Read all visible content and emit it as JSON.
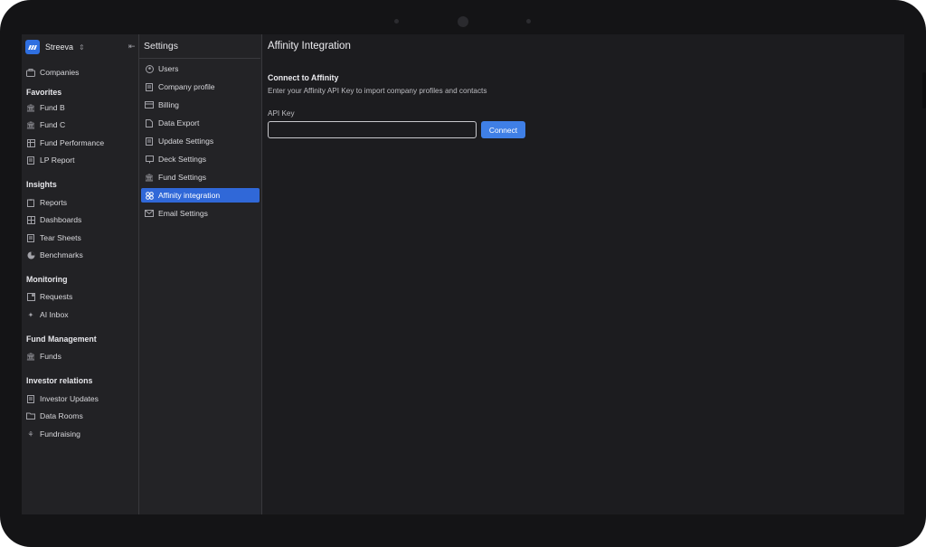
{
  "workspace": {
    "name": "Streeva"
  },
  "sidebar": {
    "top_item": {
      "label": "Companies",
      "icon": "briefcase-icon"
    },
    "sections": [
      {
        "title": "Favorites",
        "items": [
          {
            "label": "Fund B",
            "icon": "bank-icon"
          },
          {
            "label": "Fund C",
            "icon": "bank-icon"
          },
          {
            "label": "Fund Performance",
            "icon": "table-icon"
          },
          {
            "label": "LP Report",
            "icon": "document-icon"
          }
        ]
      },
      {
        "title": "Insights",
        "items": [
          {
            "label": "Reports",
            "icon": "clipboard-icon"
          },
          {
            "label": "Dashboards",
            "icon": "grid-icon"
          },
          {
            "label": "Tear Sheets",
            "icon": "document-icon"
          },
          {
            "label": "Benchmarks",
            "icon": "pie-icon"
          }
        ]
      },
      {
        "title": "Monitoring",
        "items": [
          {
            "label": "Requests",
            "icon": "request-icon"
          },
          {
            "label": "AI Inbox",
            "icon": "inbox-icon"
          }
        ]
      },
      {
        "title": "Fund Management",
        "items": [
          {
            "label": "Funds",
            "icon": "bank-icon"
          }
        ]
      },
      {
        "title": "Investor relations",
        "items": [
          {
            "label": "Investor Updates",
            "icon": "document-icon"
          },
          {
            "label": "Data Rooms",
            "icon": "folder-icon"
          },
          {
            "label": "Fundraising",
            "icon": "sprout-icon"
          }
        ]
      }
    ]
  },
  "settings": {
    "title": "Settings",
    "items": [
      {
        "label": "Users",
        "icon": "user-icon"
      },
      {
        "label": "Company profile",
        "icon": "document-icon"
      },
      {
        "label": "Billing",
        "icon": "card-icon"
      },
      {
        "label": "Data Export",
        "icon": "file-icon"
      },
      {
        "label": "Update Settings",
        "icon": "document-icon"
      },
      {
        "label": "Deck Settings",
        "icon": "deck-icon"
      },
      {
        "label": "Fund Settings",
        "icon": "bank-icon"
      },
      {
        "label": "Affinity integration",
        "icon": "affinity-icon",
        "active": true
      },
      {
        "label": "Email Settings",
        "icon": "mail-icon"
      }
    ]
  },
  "main": {
    "title": "Affinity Integration",
    "section_title": "Connect to Affinity",
    "description": "Enter your Affinity API Key to import company profiles and contacts",
    "api_key_label": "API Key",
    "api_key_value": "",
    "connect_label": "Connect"
  },
  "colors": {
    "accent": "#3068d8",
    "button": "#3f7fe6",
    "background": "#1e1e21"
  }
}
